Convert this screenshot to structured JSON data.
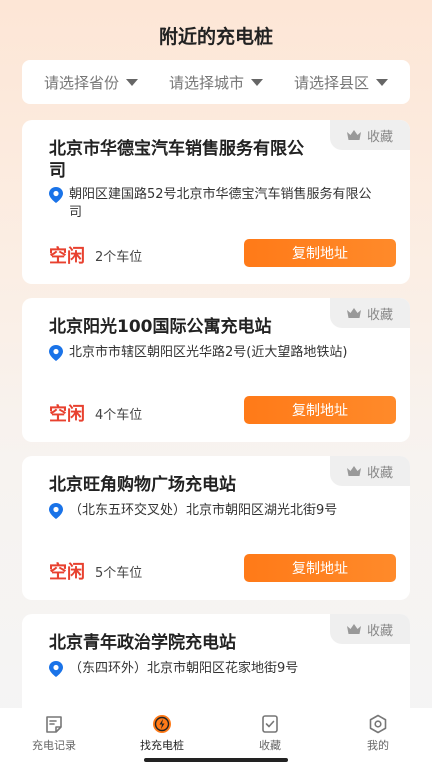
{
  "header": {
    "title": "附近的充电桩"
  },
  "filters": {
    "province": "请选择省份",
    "city": "请选择城市",
    "county": "请选择县区"
  },
  "cards": [
    {
      "title": "北京市华德宝汽车销售服务有限公司",
      "address": "朝阳区建国路52号北京市华德宝汽车销售服务有限公司",
      "status": "空闲",
      "spots": "2个车位",
      "favorite_label": "收藏",
      "copy_label": "复制地址"
    },
    {
      "title": "北京阳光100国际公寓充电站",
      "address": "北京市市辖区朝阳区光华路2号(近大望路地铁站)",
      "status": "空闲",
      "spots": "4个车位",
      "favorite_label": "收藏",
      "copy_label": "复制地址"
    },
    {
      "title": "北京旺角购物广场充电站",
      "address": "（北东五环交叉处）北京市朝阳区湖光北街9号",
      "status": "空闲",
      "spots": "5个车位",
      "favorite_label": "收藏",
      "copy_label": "复制地址"
    },
    {
      "title": "北京青年政治学院充电站",
      "address": "（东四环外）北京市朝阳区花家地街9号",
      "favorite_label": "收藏"
    }
  ],
  "tabbar": {
    "items": [
      {
        "label": "充电记录",
        "icon": "record-icon"
      },
      {
        "label": "找充电桩",
        "icon": "charge-icon",
        "active": true
      },
      {
        "label": "收藏",
        "icon": "favorite-icon"
      },
      {
        "label": "我的",
        "icon": "profile-icon"
      }
    ]
  },
  "colors": {
    "accent": "#ff7a18",
    "status_free": "#e8412f",
    "pin": "#1a73e8"
  }
}
